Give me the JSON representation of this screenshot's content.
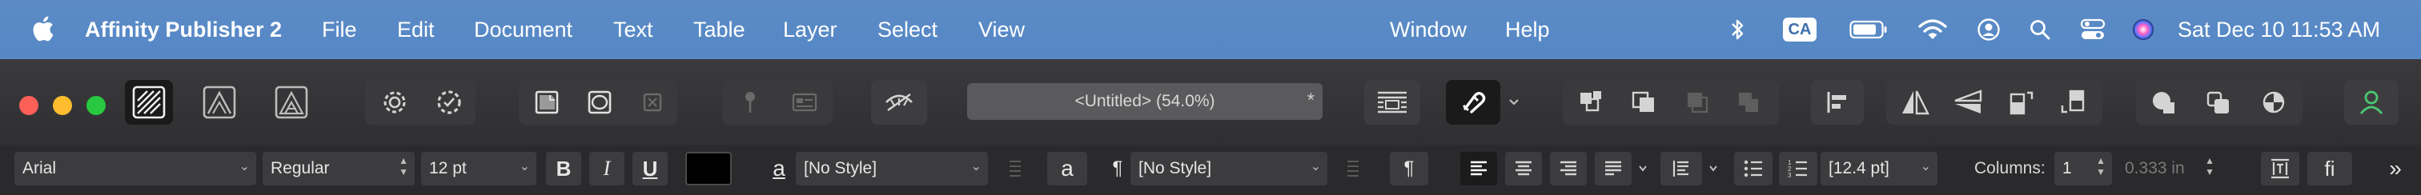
{
  "menubar": {
    "app_name": "Affinity Publisher 2",
    "items": [
      "File",
      "Edit",
      "Document",
      "Text",
      "Table",
      "Layer",
      "Select",
      "View",
      "Window",
      "Help"
    ],
    "input_source": "CA",
    "datetime": "Sat Dec 10  11:53 AM"
  },
  "toolbar": {
    "document_title": "<Untitled> (54.0%)",
    "modified_marker": "*"
  },
  "context_toolbar": {
    "font_family": "Arial",
    "font_style": "Regular",
    "font_size": "12 pt",
    "bold": "B",
    "italic": "I",
    "underline": "U",
    "char_style_icon": "a",
    "char_style": "[No Style]",
    "para_a": "a",
    "pilcrow": "¶",
    "para_style": "[No Style]",
    "pilcrow_btn": "¶",
    "leading": "[12.4 pt]",
    "columns_label": "Columns:",
    "columns_value": "1",
    "gutter_value": "0.333 in",
    "ligature": "fi",
    "more": "»",
    "text_color": "#000000"
  }
}
